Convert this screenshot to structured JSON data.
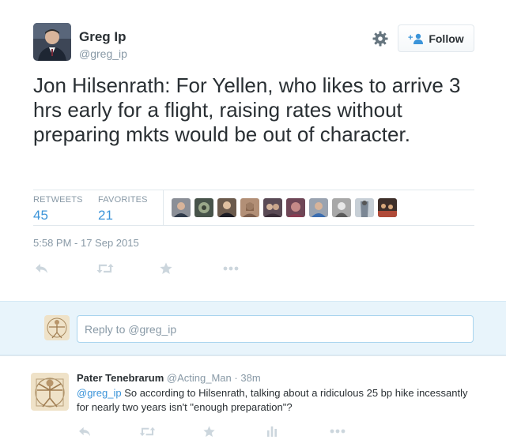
{
  "tweet": {
    "author_name": "Greg Ip",
    "author_handle": "@greg_ip",
    "follow_label": "Follow",
    "text": "Jon Hilsenrath: For Yellen, who likes to arrive 3 hrs early for a flight, raising rates without preparing mkts would be out of character.",
    "retweets_label": "RETWEETS",
    "retweets_count": "45",
    "favorites_label": "FAVORITES",
    "favorites_count": "21",
    "timestamp": "5:58 PM - 17 Sep 2015"
  },
  "reply_box": {
    "placeholder": "Reply to @greg_ip"
  },
  "reply": {
    "author_name": "Pater Tenebrarum",
    "author_handle": "@Acting_Man",
    "separator": "·",
    "time": "38m",
    "mention": "@greg_ip",
    "text": " So according to Hilsenrath, talking about a ridiculous 25 bp hike incessantly for nearly two years isn't \"enough preparation\"?"
  },
  "colors": {
    "link": "#3b94d9",
    "muted": "#8899a6",
    "text": "#292f33",
    "reply_bg": "#e8f4fb"
  },
  "icons": [
    "gear-icon",
    "follow-person-plus-icon",
    "reply-icon",
    "retweet-icon",
    "favorite-star-icon",
    "more-icon",
    "stats-icon"
  ]
}
